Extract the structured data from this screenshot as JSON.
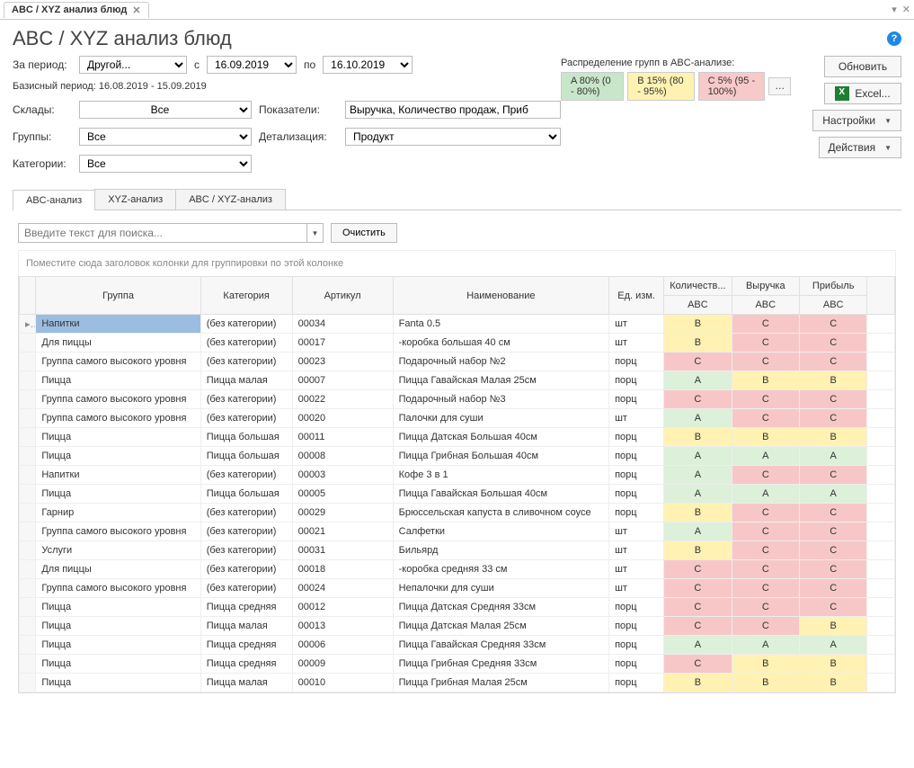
{
  "window": {
    "tab_title": "ABC / XYZ анализ блюд"
  },
  "page_title": "ABC / XYZ анализ блюд",
  "filters": {
    "period_lbl": "За период:",
    "period_value": "Другой...",
    "from_lbl": "с",
    "from_value": "16.09.2019",
    "to_lbl": "по",
    "to_value": "16.10.2019",
    "base_period": "Базисный период: 16.08.2019 - 15.09.2019",
    "stores_lbl": "Склады:",
    "stores_value": "Все",
    "groups_lbl": "Группы:",
    "groups_value": "Все",
    "categories_lbl": "Категории:",
    "categories_value": "Все",
    "metrics_lbl": "Показатели:",
    "metrics_value": "Выручка, Количество продаж, Приб",
    "detail_lbl": "Детализация:",
    "detail_value": "Продукт"
  },
  "distribution": {
    "label": "Распределение групп в ABC-анализе:",
    "a": "A 80% (0 - 80%)",
    "b": "B 15% (80 - 95%)",
    "c": "C 5% (95 - 100%)",
    "more": "…"
  },
  "actions": {
    "update": "Обновить",
    "excel": "Excel...",
    "settings": "Настройки",
    "actions": "Действия"
  },
  "subtabs": {
    "abc": "ABC-анализ",
    "xyz": "XYZ-анализ",
    "abc_xyz": "ABC / XYZ-анализ"
  },
  "toolbar": {
    "search_placeholder": "Введите текст для поиска...",
    "clear": "Очистить",
    "group_hint": "Поместите сюда заголовок колонки для группировки по этой колонке"
  },
  "columns": {
    "group": "Группа",
    "category": "Категория",
    "article": "Артикул",
    "name": "Наименование",
    "unit": "Ед. изм.",
    "qty_hdr": "Количеств...",
    "rev_hdr": "Выручка",
    "profit_hdr": "Прибыль",
    "abc_sub": "ABC"
  },
  "rows": [
    {
      "group": "Напитки",
      "cat": "(без категории)",
      "art": "00034",
      "name": "Fanta 0.5",
      "unit": "шт",
      "q": "B",
      "r": "C",
      "p": "C"
    },
    {
      "group": "Для пиццы",
      "cat": "(без категории)",
      "art": "00017",
      "name": "-коробка большая 40 см",
      "unit": "шт",
      "q": "B",
      "r": "C",
      "p": "C"
    },
    {
      "group": "Группа самого высокого уровня",
      "cat": "(без категории)",
      "art": "00023",
      "name": "Подарочный набор №2",
      "unit": "порц",
      "q": "C",
      "r": "C",
      "p": "C"
    },
    {
      "group": "Пицца",
      "cat": "Пицца малая",
      "art": "00007",
      "name": "Пицца Гавайская Малая 25см",
      "unit": "порц",
      "q": "A",
      "r": "B",
      "p": "B"
    },
    {
      "group": "Группа самого высокого уровня",
      "cat": "(без категории)",
      "art": "00022",
      "name": "Подарочный набор №3",
      "unit": "порц",
      "q": "C",
      "r": "C",
      "p": "C"
    },
    {
      "group": "Группа самого высокого уровня",
      "cat": "(без категории)",
      "art": "00020",
      "name": "Палочки для суши",
      "unit": "шт",
      "q": "A",
      "r": "C",
      "p": "C"
    },
    {
      "group": "Пицца",
      "cat": "Пицца большая",
      "art": "00011",
      "name": "Пицца Датская Большая 40см",
      "unit": "порц",
      "q": "B",
      "r": "B",
      "p": "B"
    },
    {
      "group": "Пицца",
      "cat": "Пицца большая",
      "art": "00008",
      "name": "Пицца Грибная Большая 40см",
      "unit": "порц",
      "q": "A",
      "r": "A",
      "p": "A"
    },
    {
      "group": "Напитки",
      "cat": "(без категории)",
      "art": "00003",
      "name": "Кофе 3 в 1",
      "unit": "порц",
      "q": "A",
      "r": "C",
      "p": "C"
    },
    {
      "group": "Пицца",
      "cat": "Пицца большая",
      "art": "00005",
      "name": "Пицца Гавайская Большая 40см",
      "unit": "порц",
      "q": "A",
      "r": "A",
      "p": "A"
    },
    {
      "group": "Гарнир",
      "cat": "(без категории)",
      "art": "00029",
      "name": "Брюссельская капуста в сливочном соусе",
      "unit": "порц",
      "q": "B",
      "r": "C",
      "p": "C"
    },
    {
      "group": "Группа самого высокого уровня",
      "cat": "(без категории)",
      "art": "00021",
      "name": "Салфетки",
      "unit": "шт",
      "q": "A",
      "r": "C",
      "p": "C"
    },
    {
      "group": "Услуги",
      "cat": "(без категории)",
      "art": "00031",
      "name": "Бильярд",
      "unit": "шт",
      "q": "B",
      "r": "C",
      "p": "C"
    },
    {
      "group": "Для пиццы",
      "cat": "(без категории)",
      "art": "00018",
      "name": "-коробка средняя 33 см",
      "unit": "шт",
      "q": "C",
      "r": "C",
      "p": "C"
    },
    {
      "group": "Группа самого высокого уровня",
      "cat": "(без категории)",
      "art": "00024",
      "name": "Непалочки для суши",
      "unit": "шт",
      "q": "C",
      "r": "C",
      "p": "C"
    },
    {
      "group": "Пицца",
      "cat": "Пицца средняя",
      "art": "00012",
      "name": "Пицца Датская Средняя 33см",
      "unit": "порц",
      "q": "C",
      "r": "C",
      "p": "C"
    },
    {
      "group": "Пицца",
      "cat": "Пицца малая",
      "art": "00013",
      "name": "Пицца Датская Малая 25см",
      "unit": "порц",
      "q": "C",
      "r": "C",
      "p": "B"
    },
    {
      "group": "Пицца",
      "cat": "Пицца средняя",
      "art": "00006",
      "name": "Пицца Гавайская Средняя 33см",
      "unit": "порц",
      "q": "A",
      "r": "A",
      "p": "A"
    },
    {
      "group": "Пицца",
      "cat": "Пицца средняя",
      "art": "00009",
      "name": "Пицца Грибная Средняя 33см",
      "unit": "порц",
      "q": "C",
      "r": "B",
      "p": "B"
    },
    {
      "group": "Пицца",
      "cat": "Пицца малая",
      "art": "00010",
      "name": "Пицца Грибная Малая 25см",
      "unit": "порц",
      "q": "B",
      "r": "B",
      "p": "B"
    }
  ]
}
